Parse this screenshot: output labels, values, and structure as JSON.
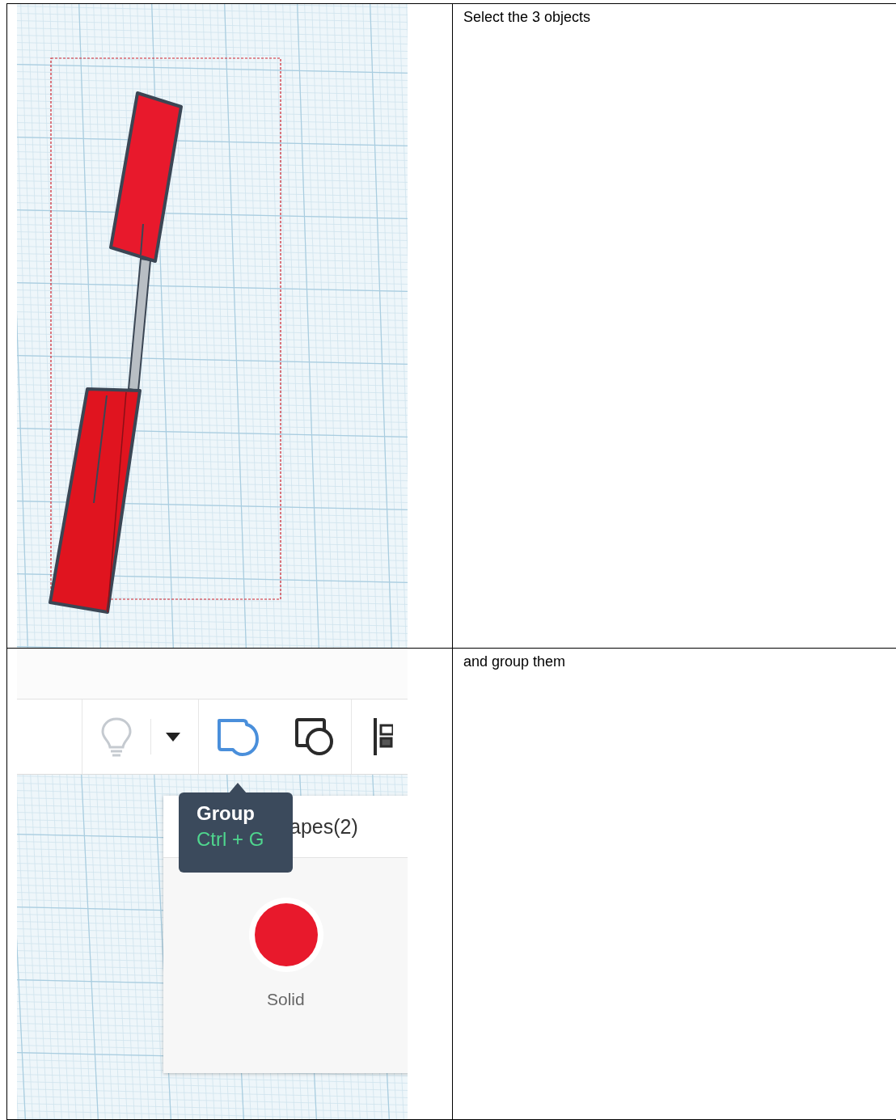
{
  "steps": [
    {
      "kind": "selection",
      "instruction": "Select the 3 objects"
    },
    {
      "kind": "toolbar",
      "instruction": "and group them",
      "tooltip": {
        "title": "Group",
        "shortcut": "Ctrl + G"
      },
      "panel": {
        "header": "apes(2)",
        "swatch_label": "Solid"
      }
    }
  ]
}
